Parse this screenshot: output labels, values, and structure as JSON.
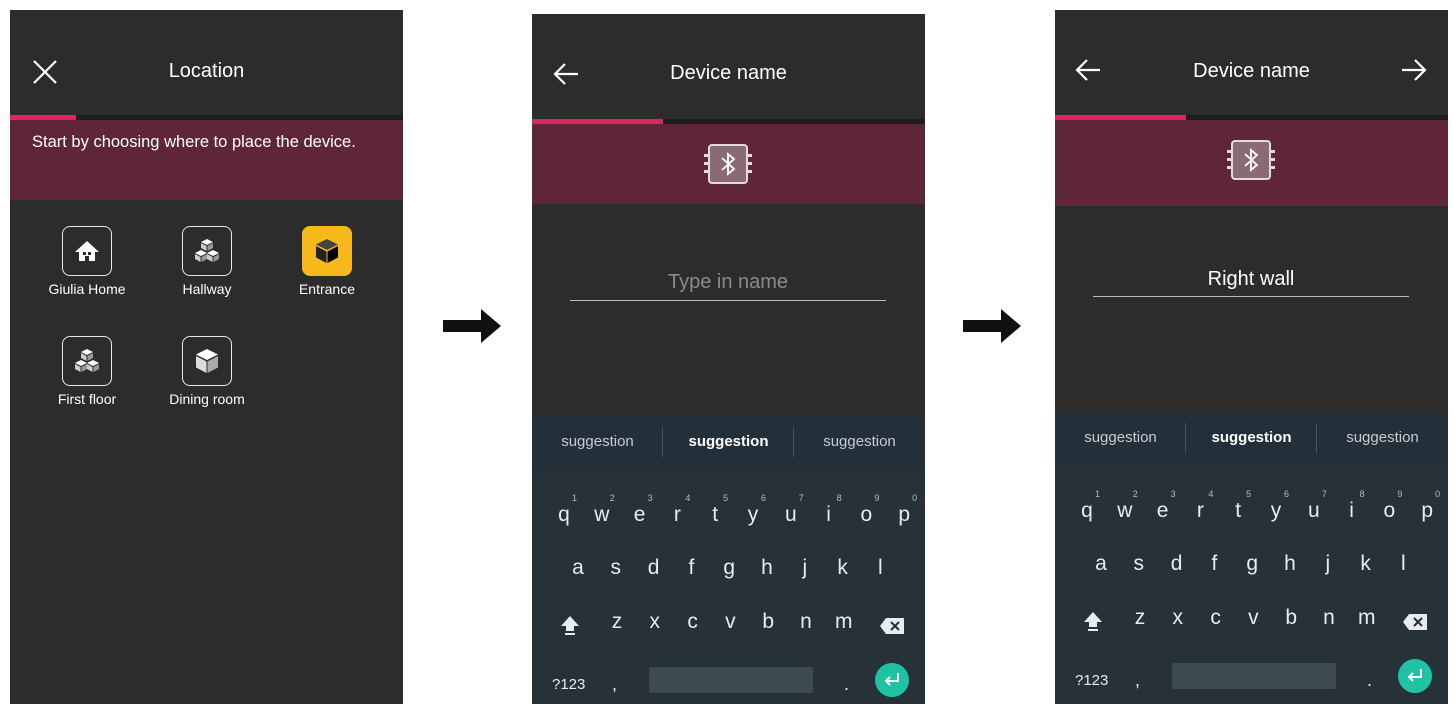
{
  "screen1": {
    "title": "Location",
    "close_icon": "close-icon",
    "progress_fraction": 0.167,
    "instruction": "Start by choosing where to place the device.",
    "locations": [
      {
        "label": "Giulia Home",
        "icon": "house-icon",
        "selected": false
      },
      {
        "label": "Hallway",
        "icon": "cubes-icon",
        "selected": false
      },
      {
        "label": "Entrance",
        "icon": "cube-icon",
        "selected": true
      },
      {
        "label": "First floor",
        "icon": "cubes-icon",
        "selected": false
      },
      {
        "label": "Dining room",
        "icon": "cube-icon",
        "selected": false
      }
    ]
  },
  "screen2": {
    "title": "Device name",
    "back_icon": "arrow-left-icon",
    "progress_fraction": 0.333,
    "device_icon": "bluetooth-chip-icon",
    "name_placeholder": "Type in name",
    "name_value": ""
  },
  "screen3": {
    "title": "Device name",
    "back_icon": "arrow-left-icon",
    "next_icon": "arrow-right-icon",
    "progress_fraction": 0.333,
    "device_icon": "bluetooth-chip-icon",
    "name_value": "Right wall"
  },
  "keyboard": {
    "suggestions": [
      "suggestion",
      "suggestion",
      "suggestion"
    ],
    "row1": [
      {
        "k": "q",
        "n": "1"
      },
      {
        "k": "w",
        "n": "2"
      },
      {
        "k": "e",
        "n": "3"
      },
      {
        "k": "r",
        "n": "4"
      },
      {
        "k": "t",
        "n": "5"
      },
      {
        "k": "y",
        "n": "6"
      },
      {
        "k": "u",
        "n": "7"
      },
      {
        "k": "i",
        "n": "8"
      },
      {
        "k": "o",
        "n": "9"
      },
      {
        "k": "p",
        "n": "0"
      }
    ],
    "row2": [
      "a",
      "s",
      "d",
      "f",
      "g",
      "h",
      "j",
      "k",
      "l"
    ],
    "row3": [
      "z",
      "x",
      "c",
      "v",
      "b",
      "n",
      "m"
    ],
    "symbols_label": "?123",
    "comma": ",",
    "period": ".",
    "enter_color": "#1fc3a4"
  },
  "colors": {
    "background": "#2c2c2d",
    "accent_band": "#5e2638",
    "progress": "#e0245e",
    "selected_tile": "#f6b81a",
    "keyboard": "#263238"
  }
}
